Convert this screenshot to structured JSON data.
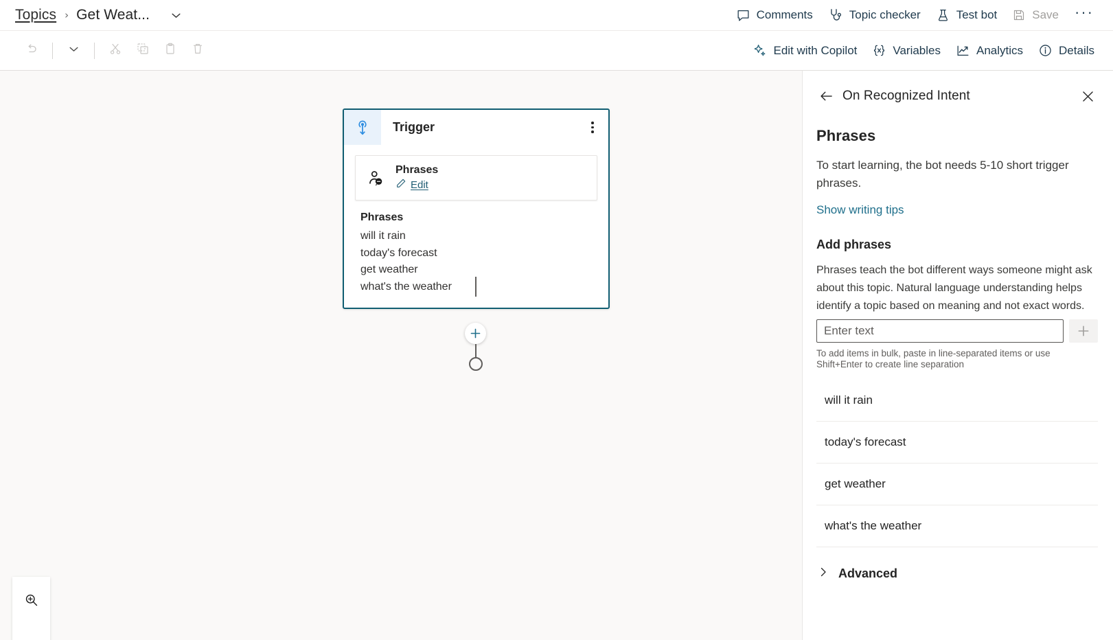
{
  "breadcrumb": {
    "root_label": "Topics",
    "separator": "›",
    "current_label": "Get Weat...",
    "caret_icon": "chevron-down-icon"
  },
  "topbar": {
    "actions": [
      {
        "label": "Comments",
        "icon": "comment-icon",
        "disabled": false
      },
      {
        "label": "Topic checker",
        "icon": "stethoscope-icon",
        "disabled": false
      },
      {
        "label": "Test bot",
        "icon": "flask-icon",
        "disabled": false
      },
      {
        "label": "Save",
        "icon": "save-icon",
        "disabled": true
      }
    ],
    "more_label": "···"
  },
  "toolbar": {
    "left_tools": [
      {
        "name": "undo-icon",
        "enabled": false
      },
      {
        "name": "chevron-down-icon",
        "enabled": true
      },
      {
        "name": "cut-icon",
        "enabled": false
      },
      {
        "name": "copy-icon",
        "enabled": false
      },
      {
        "name": "paste-icon",
        "enabled": false
      },
      {
        "name": "delete-icon",
        "enabled": false
      }
    ],
    "right_tools": [
      {
        "label": "Edit with Copilot",
        "icon": "sparkle-icon"
      },
      {
        "label": "Variables",
        "icon": "braces-x-icon"
      },
      {
        "label": "Analytics",
        "icon": "trend-line-icon"
      },
      {
        "label": "Details",
        "icon": "info-circle-icon"
      }
    ]
  },
  "canvas": {
    "node": {
      "icon": "trigger-pin-icon",
      "title": "Trigger",
      "kebab": "more-options-icon",
      "subcard": {
        "icon": "person-speech-icon",
        "title": "Phrases",
        "edit_label": "Edit",
        "edit_icon": "pencil-icon"
      },
      "phrases_heading": "Phrases",
      "phrases": [
        "will it rain",
        "today's forecast",
        "get weather",
        "what's the weather"
      ]
    },
    "add_node_icon": "plus-icon",
    "zoom_control": {
      "icon": "zoom-in-icon"
    }
  },
  "panel": {
    "back_icon": "arrow-left-icon",
    "header_title": "On Recognized Intent",
    "close_icon": "close-icon",
    "title": "Phrases",
    "description": "To start learning, the bot needs 5-10 short trigger phrases.",
    "writing_tips_link": "Show writing tips",
    "add_phrases_heading": "Add phrases",
    "add_phrases_description": "Phrases teach the bot different ways someone might ask about this topic. Natural language understanding helps identify a topic based on meaning and not exact words.",
    "input": {
      "value": "",
      "placeholder": "Enter text"
    },
    "add_button_icon": "plus-icon",
    "bulk_hint": "To add items in bulk, paste in line-separated items or use Shift+Enter to create line separation",
    "phrases": [
      "will it rain",
      "today's forecast",
      "get weather",
      "what's the weather"
    ],
    "advanced": {
      "label": "Advanced",
      "icon": "chevron-right-icon"
    }
  },
  "colors": {
    "accent": "#1f6f8b",
    "node_border": "#115e72",
    "canvas_bg": "#faf9f8",
    "trigger_icon": "#2e8de0"
  }
}
